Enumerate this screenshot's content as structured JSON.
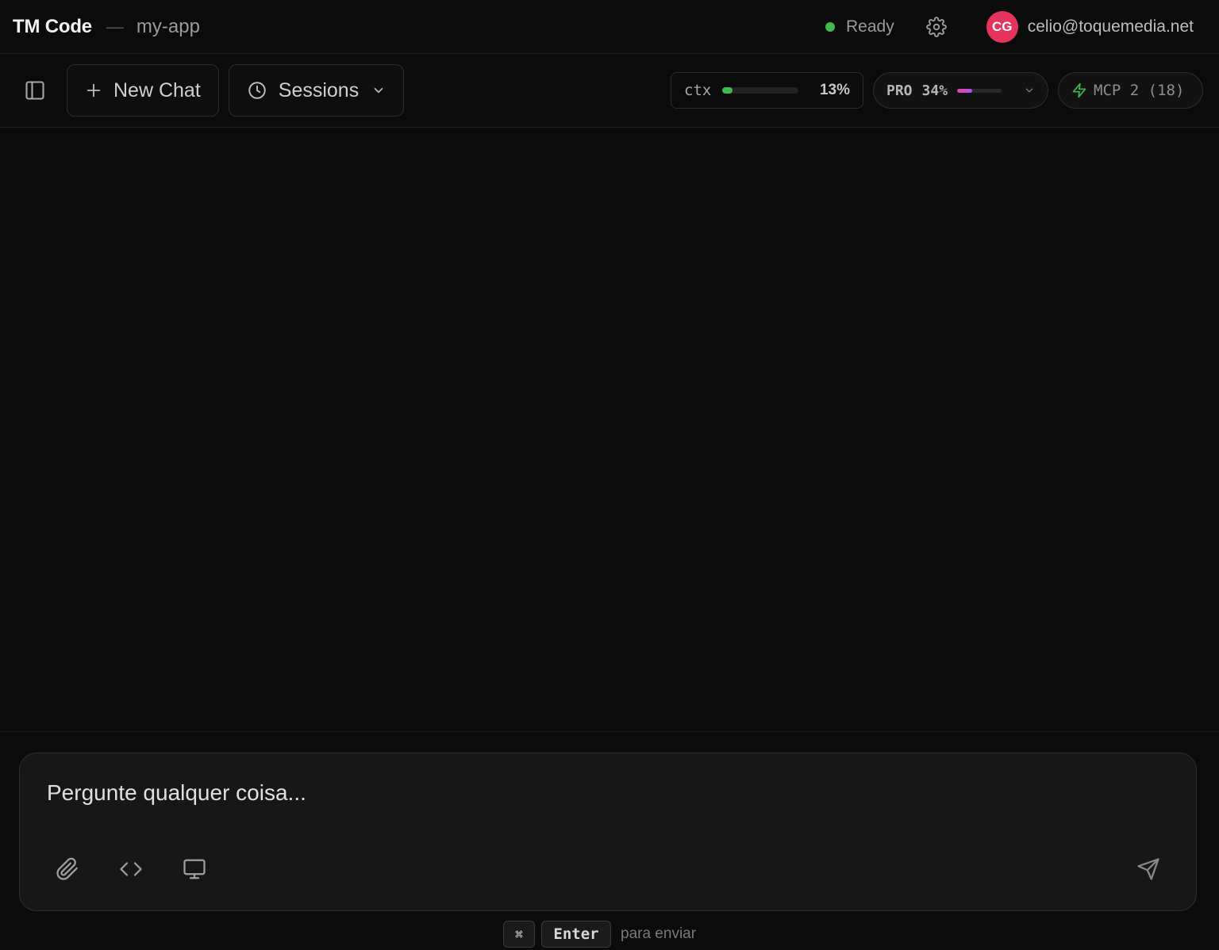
{
  "titlebar": {
    "app_title": "TM Code",
    "separator": "—",
    "project": "my-app",
    "status": "Ready",
    "status_color": "#3fb950",
    "settings_icon": "gear-icon",
    "avatar_initials": "CG",
    "avatar_color": "#e5335c",
    "email": "celio@toquemedia.net"
  },
  "toolbar": {
    "sidebar_toggle_icon": "sidebar-icon",
    "new_chat_label": "New Chat",
    "sessions_label": "Sessions",
    "ctx": {
      "label": "ctx",
      "percent_text": "13%",
      "percent": 13,
      "color": "#3fb950"
    },
    "pro": {
      "label": "PRO",
      "percent_text": "34%",
      "percent": 34
    },
    "mcp": {
      "label": "MCP 2 (18)"
    }
  },
  "composer": {
    "placeholder": "Pergunte qualquer coisa...",
    "tools": [
      "paperclip-icon",
      "code-icon",
      "monitor-icon"
    ],
    "send_icon": "send-icon"
  },
  "hint": {
    "cmd_key": "⌘",
    "enter_key": "Enter",
    "text": "para enviar"
  }
}
